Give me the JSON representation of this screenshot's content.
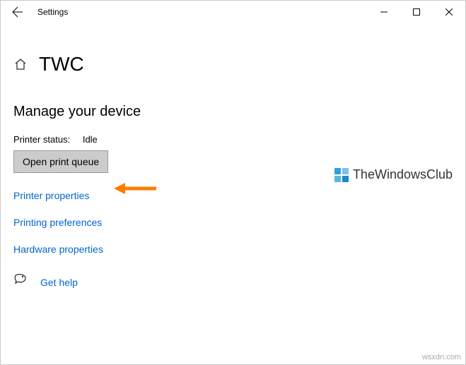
{
  "window": {
    "title": "Settings"
  },
  "header": {
    "printerName": "TWC"
  },
  "section": {
    "title": "Manage your device"
  },
  "status": {
    "label": "Printer status:",
    "value": "Idle"
  },
  "buttons": {
    "openQueue": "Open print queue"
  },
  "links": {
    "printerProperties": "Printer properties",
    "printingPreferences": "Printing preferences",
    "hardwareProperties": "Hardware properties",
    "getHelp": "Get help"
  },
  "watermark": {
    "text": "TheWindowsClub"
  },
  "credit": "wsxdn.com"
}
